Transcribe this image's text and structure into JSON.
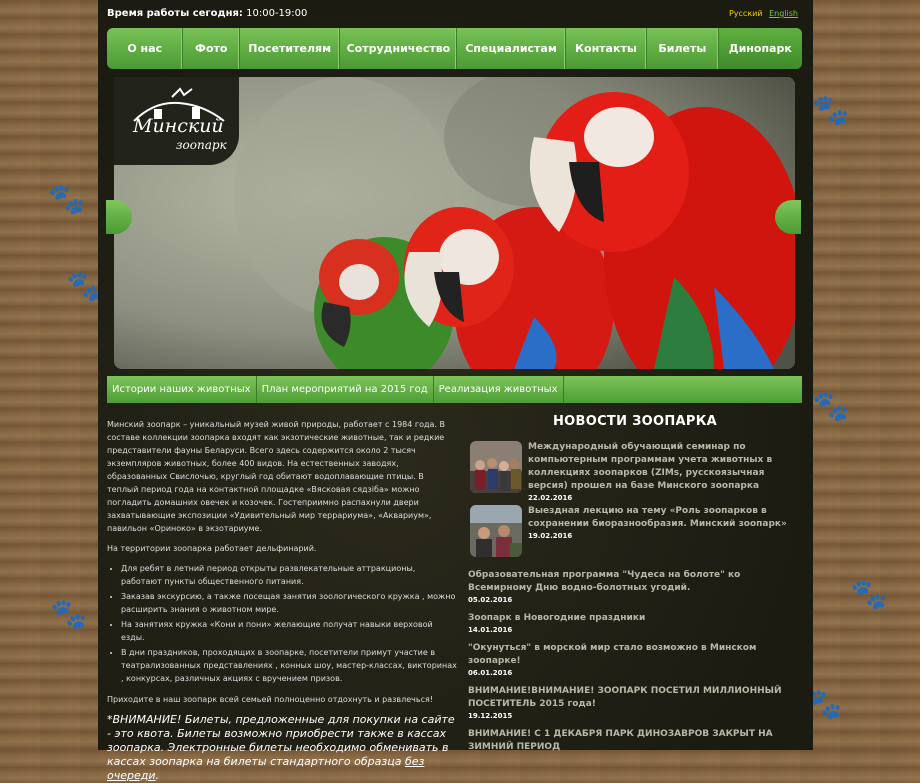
{
  "topbar": {
    "hours_label": "Время работы сегодня:",
    "hours_value": "10:00-19:00",
    "lang_ru": "Русский",
    "lang_en": "English"
  },
  "nav": {
    "items": [
      "О нас",
      "Фото",
      "Посетителям",
      "Сотрудничество",
      "Специалистам",
      "Контакты",
      "Билеты",
      "Динопарк"
    ]
  },
  "logo": {
    "title": "Минский",
    "subtitle": "зоопарк"
  },
  "subnav": {
    "items": [
      "Истории наших животных",
      "План мероприятий на 2015 год",
      "Реализация животных"
    ]
  },
  "intro": {
    "p1": "Минский зоопарк – уникальный музей живой природы, работает с 1984 года. В составе коллекции зоопарка входят как экзотические животные, так и редкие представители фауны Беларуси. Всего здесь содержится около 2 тысяч экземпляров животных, более 400 видов. На естественных заводях, образованных Свислочью, круглый год обитают водоплавающие птицы. В теплый период года на контактной площадке «Вясковая сядзіба» можно погладить домашних овечек и козочек. Гостеприимно распахнули двери захватывающие экспозиции «Удивительный мир террариума», «Аквариум», павильон «Ориноко» в экзотариуме.",
    "p2": "На территории зоопарка работает дельфинарий.",
    "bullets": [
      "Для ребят в летний период открыты развлекательные аттракционы, работают пункты общественного питания.",
      "Заказав экскурсию, а также посещая занятия зоологического кружка , можно расширить знания о животном мире.",
      "На занятиях кружка «Кони и пони» желающие получат навыки верховой езды.",
      "В дни праздников, проходящих в зоопарке, посетители примут участие в театрализованных представлениях , конных шоу, мастер-классах, викторинах , конкурсах, различных акциях с вручением призов."
    ],
    "p3": "Приходите в наш зоопарк всей семьей полноценно отдохнуть и развлечься!",
    "warning_text": "*ВНИМАНИЕ! Билеты, предложенные для покупки на сайте - это квота. Билеты возможно приобрести также в кассах зоопарка. Электронные билеты необходимо обменивать в кассах зоопарка на билеты стандартного образца ",
    "warning_link": "без очереди",
    "warning_end": "."
  },
  "news": {
    "title": "НОВОСТИ ЗООПАРКА",
    "items": [
      {
        "text": "Международный обучающий семинар по компьютерным программам учета животных в коллекциях зоопарков (ZIMs, русскоязычная версия) прошел на базе Минского зоопарка",
        "date": "22.02.2016"
      },
      {
        "text": "Выездная лекцию на тему «Роль зоопарков в сохранении биоразнообразия. Минский зоопарк»",
        "date": "19.02.2016"
      },
      {
        "text": "Образовательная программа \"Чудеса на болоте\" ко Всемирному Дню водно-болотных угодий.",
        "date": "05.02.2016"
      },
      {
        "text": "Зоопарк в Новогодние праздники",
        "date": "14.01.2016"
      },
      {
        "text": "\"Окунуться\" в морской мир стало возможно в Минском зоопарке!",
        "date": "06.01.2016"
      },
      {
        "text": "ВНИМАНИЕ!ВНИМАНИЕ! ЗООПАРК ПОСЕТИЛ МИЛЛИОННЫЙ ПОСЕТИТЕЛЬ 2015 года!",
        "date": "19.12.2015"
      },
      {
        "text": "ВНИМАНИЕ! С 1 ДЕКАБРЯ ПАРК ДИНОЗАВРОВ ЗАКРЫТ НА ЗИМНИЙ ПЕРИОД",
        "date": ""
      }
    ]
  },
  "icons": {
    "paw": "paw-print-icon",
    "logo_bird": "bird-icon"
  }
}
